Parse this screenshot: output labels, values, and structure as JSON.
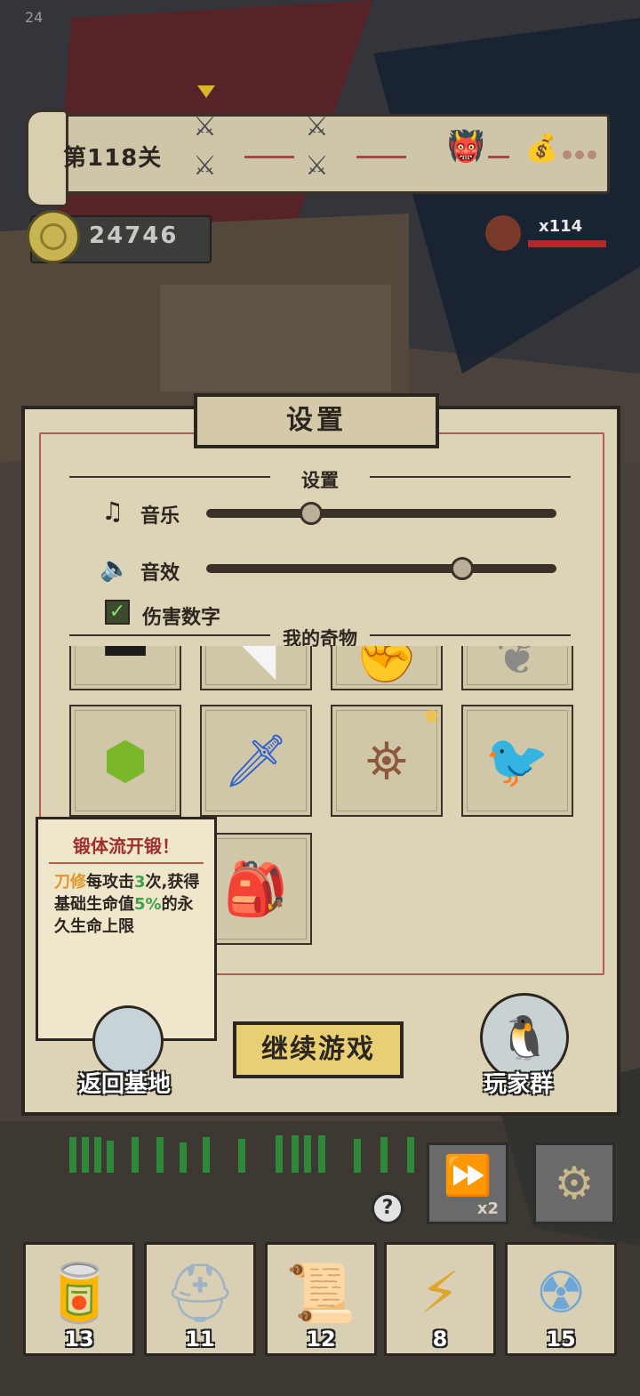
{
  "status": {
    "fps": "24"
  },
  "level": {
    "label": "第118关"
  },
  "resources": {
    "coins": "24746",
    "enemy_count": "x114"
  },
  "settings_dialog": {
    "title": "设置",
    "section_settings": "设置",
    "music_label": "音乐",
    "music_level": 0.3,
    "sfx_label": "音效",
    "sfx_level": 0.73,
    "damage_numbers_label": "伤害数字",
    "damage_numbers_checked": true,
    "section_items": "我的奇物"
  },
  "items": [
    {
      "icon": "item-dark-box-icon"
    },
    {
      "icon": "item-white-feather-icon"
    },
    {
      "icon": "item-fist-icon"
    },
    {
      "icon": "item-grey-feather-icon"
    },
    {
      "icon": "item-green-armor-orb-icon"
    },
    {
      "icon": "item-blue-sword-icon"
    },
    {
      "icon": "item-spiked-shield-icon",
      "starred": true
    },
    {
      "icon": "item-blue-pigeon-icon"
    },
    {
      "icon": "item-hidden-icon"
    },
    {
      "icon": "item-backpack-icon"
    }
  ],
  "tooltip": {
    "title": "锻体流开锻！",
    "body_part1": "刀修",
    "body_part2": "每攻击",
    "body_part3": "3",
    "body_part4": "次,获得基础生命值",
    "body_part5": "5%",
    "body_part6": "的永久生命上限"
  },
  "buttons": {
    "return_base": "返回基地",
    "continue_game": "继续游戏",
    "player_group": "玩家群"
  },
  "hud": {
    "speed_label": "x2",
    "consumables": [
      {
        "name": "cola-can-icon",
        "count": "13"
      },
      {
        "name": "first-aid-kit-icon",
        "count": "11"
      },
      {
        "name": "scroll-icon",
        "count": "12"
      },
      {
        "name": "lightning-card-icon",
        "count": "8"
      },
      {
        "name": "nuke-bomb-icon",
        "count": "15"
      }
    ]
  },
  "colors": {
    "parchment": "#ddd3b6",
    "frame": "#2c2620",
    "accent_red": "#a12d2a",
    "continue_yellow": "#e9cf73"
  }
}
